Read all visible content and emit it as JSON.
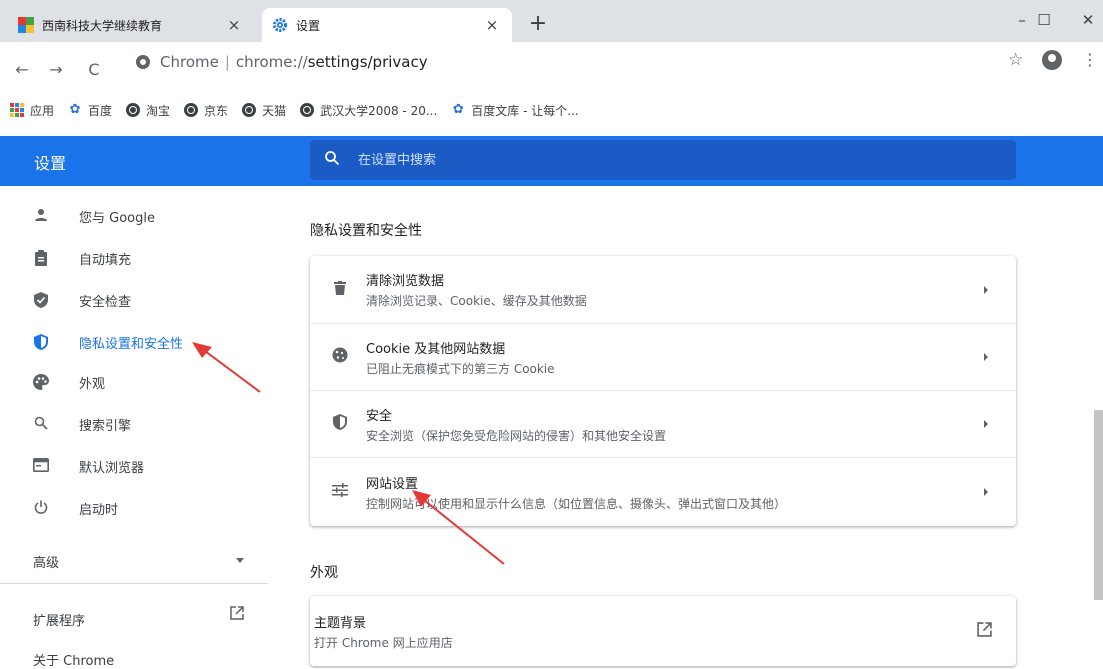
{
  "browser": {
    "tabs": [
      {
        "title": "西南科技大学继续教育",
        "close": "×"
      },
      {
        "title": "设置",
        "close": "×"
      }
    ],
    "new_tab": "+",
    "window_controls": {
      "minimize": "–",
      "maximize": "☐",
      "close": "✕"
    },
    "nav": {
      "back": "←",
      "forward": "→",
      "reload": "C"
    },
    "omnibox": {
      "site": "Chrome",
      "separator": "|",
      "scheme": "chrome://",
      "path": "settings/privacy"
    },
    "star": "☆",
    "menu": "⋮"
  },
  "bookmarks": [
    {
      "label": "应用",
      "icon": "apps-icon"
    },
    {
      "label": "百度",
      "icon": "baidu-paw-icon"
    },
    {
      "label": "淘宝",
      "icon": "globe-icon"
    },
    {
      "label": "京东",
      "icon": "globe-icon"
    },
    {
      "label": "天猫",
      "icon": "globe-icon"
    },
    {
      "label": "武汉大学2008 - 20...",
      "icon": "globe-icon"
    },
    {
      "label": "百度文库 - 让每个...",
      "icon": "baidu-paw-icon"
    }
  ],
  "header": {
    "title": "设置",
    "search_placeholder": "在设置中搜索"
  },
  "sidebar": {
    "items": [
      {
        "label": "您与 Google",
        "icon": "person-icon"
      },
      {
        "label": "自动填充",
        "icon": "clipboard-icon"
      },
      {
        "label": "安全检查",
        "icon": "shield-check-icon"
      },
      {
        "label": "隐私设置和安全性",
        "icon": "privacy-shield-icon",
        "active": true
      },
      {
        "label": "外观",
        "icon": "palette-icon"
      },
      {
        "label": "搜索引擎",
        "icon": "search-icon"
      },
      {
        "label": "默认浏览器",
        "icon": "browser-window-icon"
      },
      {
        "label": "启动时",
        "icon": "power-icon"
      }
    ],
    "advanced": "高级",
    "extensions": "扩展程序",
    "about": "关于 Chrome"
  },
  "main": {
    "privacy_section_title": "隐私设置和安全性",
    "privacy_rows": [
      {
        "title": "清除浏览数据",
        "subtitle": "清除浏览记录、Cookie、缓存及其他数据",
        "icon": "trash-icon"
      },
      {
        "title": "Cookie 及其他网站数据",
        "subtitle": "已阻止无痕模式下的第三方 Cookie",
        "icon": "cookie-icon"
      },
      {
        "title": "安全",
        "subtitle": "安全浏览（保护您免受危险网站的侵害）和其他安全设置",
        "icon": "security-shield-icon"
      },
      {
        "title": "网站设置",
        "subtitle": "控制网站可以使用和显示什么信息（如位置信息、摄像头、弹出式窗口及其他）",
        "icon": "sliders-icon"
      }
    ],
    "appearance_section_title": "外观",
    "appearance_rows": [
      {
        "title": "主题背景",
        "subtitle": "打开 Chrome 网上应用店",
        "icon": "external-link-icon"
      }
    ]
  },
  "colors": {
    "accent": "#1a73e8",
    "annotation_arrow": "#e53935"
  }
}
